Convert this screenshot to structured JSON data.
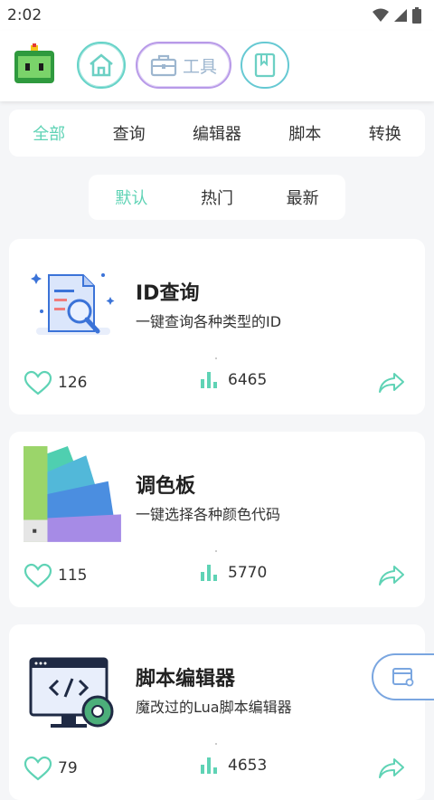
{
  "status_bar": {
    "time": "2:02"
  },
  "header": {
    "tools_label": "工具"
  },
  "categories": [
    "全部",
    "查询",
    "编辑器",
    "脚本",
    "转换"
  ],
  "sort_tabs": [
    "默认",
    "热门",
    "最新"
  ],
  "cards": [
    {
      "title": "ID查询",
      "desc": "一键查询各种类型的ID",
      "likes": "126",
      "views": "6465",
      "icon": "id-search-illustration"
    },
    {
      "title": "调色板",
      "desc": "一键选择各种颜色代码",
      "likes": "115",
      "views": "5770",
      "icon": "color-palette-illustration"
    },
    {
      "title": "脚本编辑器",
      "desc": "魔改过的Lua脚本编辑器",
      "likes": "79",
      "views": "4653",
      "icon": "code-editor-illustration"
    }
  ],
  "colors": {
    "accent": "#5fd3b5",
    "purple": "#b89ae8",
    "blue": "#7aa6e0"
  }
}
